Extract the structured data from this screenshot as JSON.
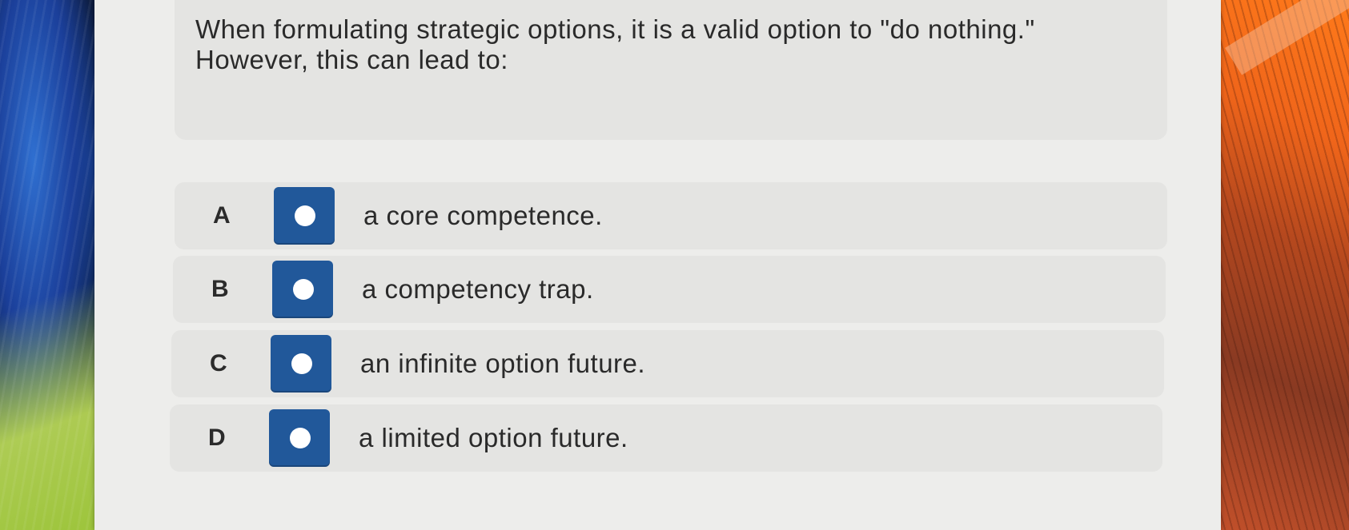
{
  "question": {
    "text": "When formulating strategic options, it is a valid option to \"do nothing.\" However, this can lead to:"
  },
  "options": [
    {
      "letter": "A",
      "text": "a core competence.",
      "selected": false
    },
    {
      "letter": "B",
      "text": "a competency trap.",
      "selected": false
    },
    {
      "letter": "C",
      "text": "an infinite option future.",
      "selected": false
    },
    {
      "letter": "D",
      "text": "a limited option future.",
      "selected": false
    }
  ],
  "colors": {
    "radio_button": "#21589a",
    "panel": "#ededeb",
    "option_row": "#e4e4e2"
  }
}
